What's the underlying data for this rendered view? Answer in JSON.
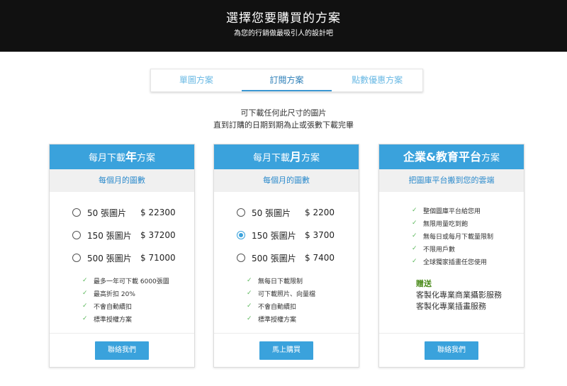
{
  "header": {
    "title": "選擇您要購買的方案",
    "subtitle": "為您的行銷做最吸引人的設計吧"
  },
  "tabs": [
    {
      "label": "單圖方案",
      "active": false
    },
    {
      "label": "訂閱方案",
      "active": true
    },
    {
      "label": "點數優惠方案",
      "active": false
    }
  ],
  "intro": {
    "line1": "可下載任何此尺寸的圖片",
    "line2": "直到訂購的日期到期為止或張數下載完畢"
  },
  "plans": [
    {
      "title_pre": "每月下載",
      "title_big": "年",
      "title_post": "方案",
      "subtitle": "每個月的圖數",
      "options": [
        {
          "label": "50 張圖片",
          "price": "$ 22300",
          "selected": false
        },
        {
          "label": "150 張圖片",
          "price": "$ 37200",
          "selected": false
        },
        {
          "label": "500 張圖片",
          "price": "$ 71000",
          "selected": false
        }
      ],
      "features": [
        "最多一年可下載 6000張圖",
        "最高折扣 20%",
        "不會自動續扣",
        "標準授權方案"
      ],
      "button": "聯絡我們"
    },
    {
      "title_pre": "每月下載",
      "title_big": "月",
      "title_post": "方案",
      "subtitle": "每個月的圖數",
      "options": [
        {
          "label": "50 張圖片",
          "price": "$ 2200",
          "selected": false
        },
        {
          "label": "150 張圖片",
          "price": "$ 3700",
          "selected": true
        },
        {
          "label": "500 張圖片",
          "price": "$ 7400",
          "selected": false
        }
      ],
      "features": [
        "無每日下載限制",
        "可下載照片、向量檔",
        "不會自動續扣",
        "標準授權方案"
      ],
      "button": "馬上購買"
    },
    {
      "title_pre": "",
      "title_big": "企業&教育平台",
      "title_post": "方案",
      "subtitle": "把圖庫平台搬到您的雲端",
      "features": [
        "整個圖庫平台給您用",
        "無限用量吃到飽",
        "無每日或每月下載量限制",
        "不限用戶數",
        "全球獨家插畫任您使用"
      ],
      "gift_title": "贈送",
      "gift_lines": [
        "客製化專業商業攝影服務",
        "客製化專業插畫服務"
      ],
      "button": "聯絡我們"
    }
  ],
  "colors": {
    "accent": "#3aa2dc",
    "header_bg": "#111111",
    "check": "#5cb85c",
    "gift": "#4a8a1a"
  }
}
